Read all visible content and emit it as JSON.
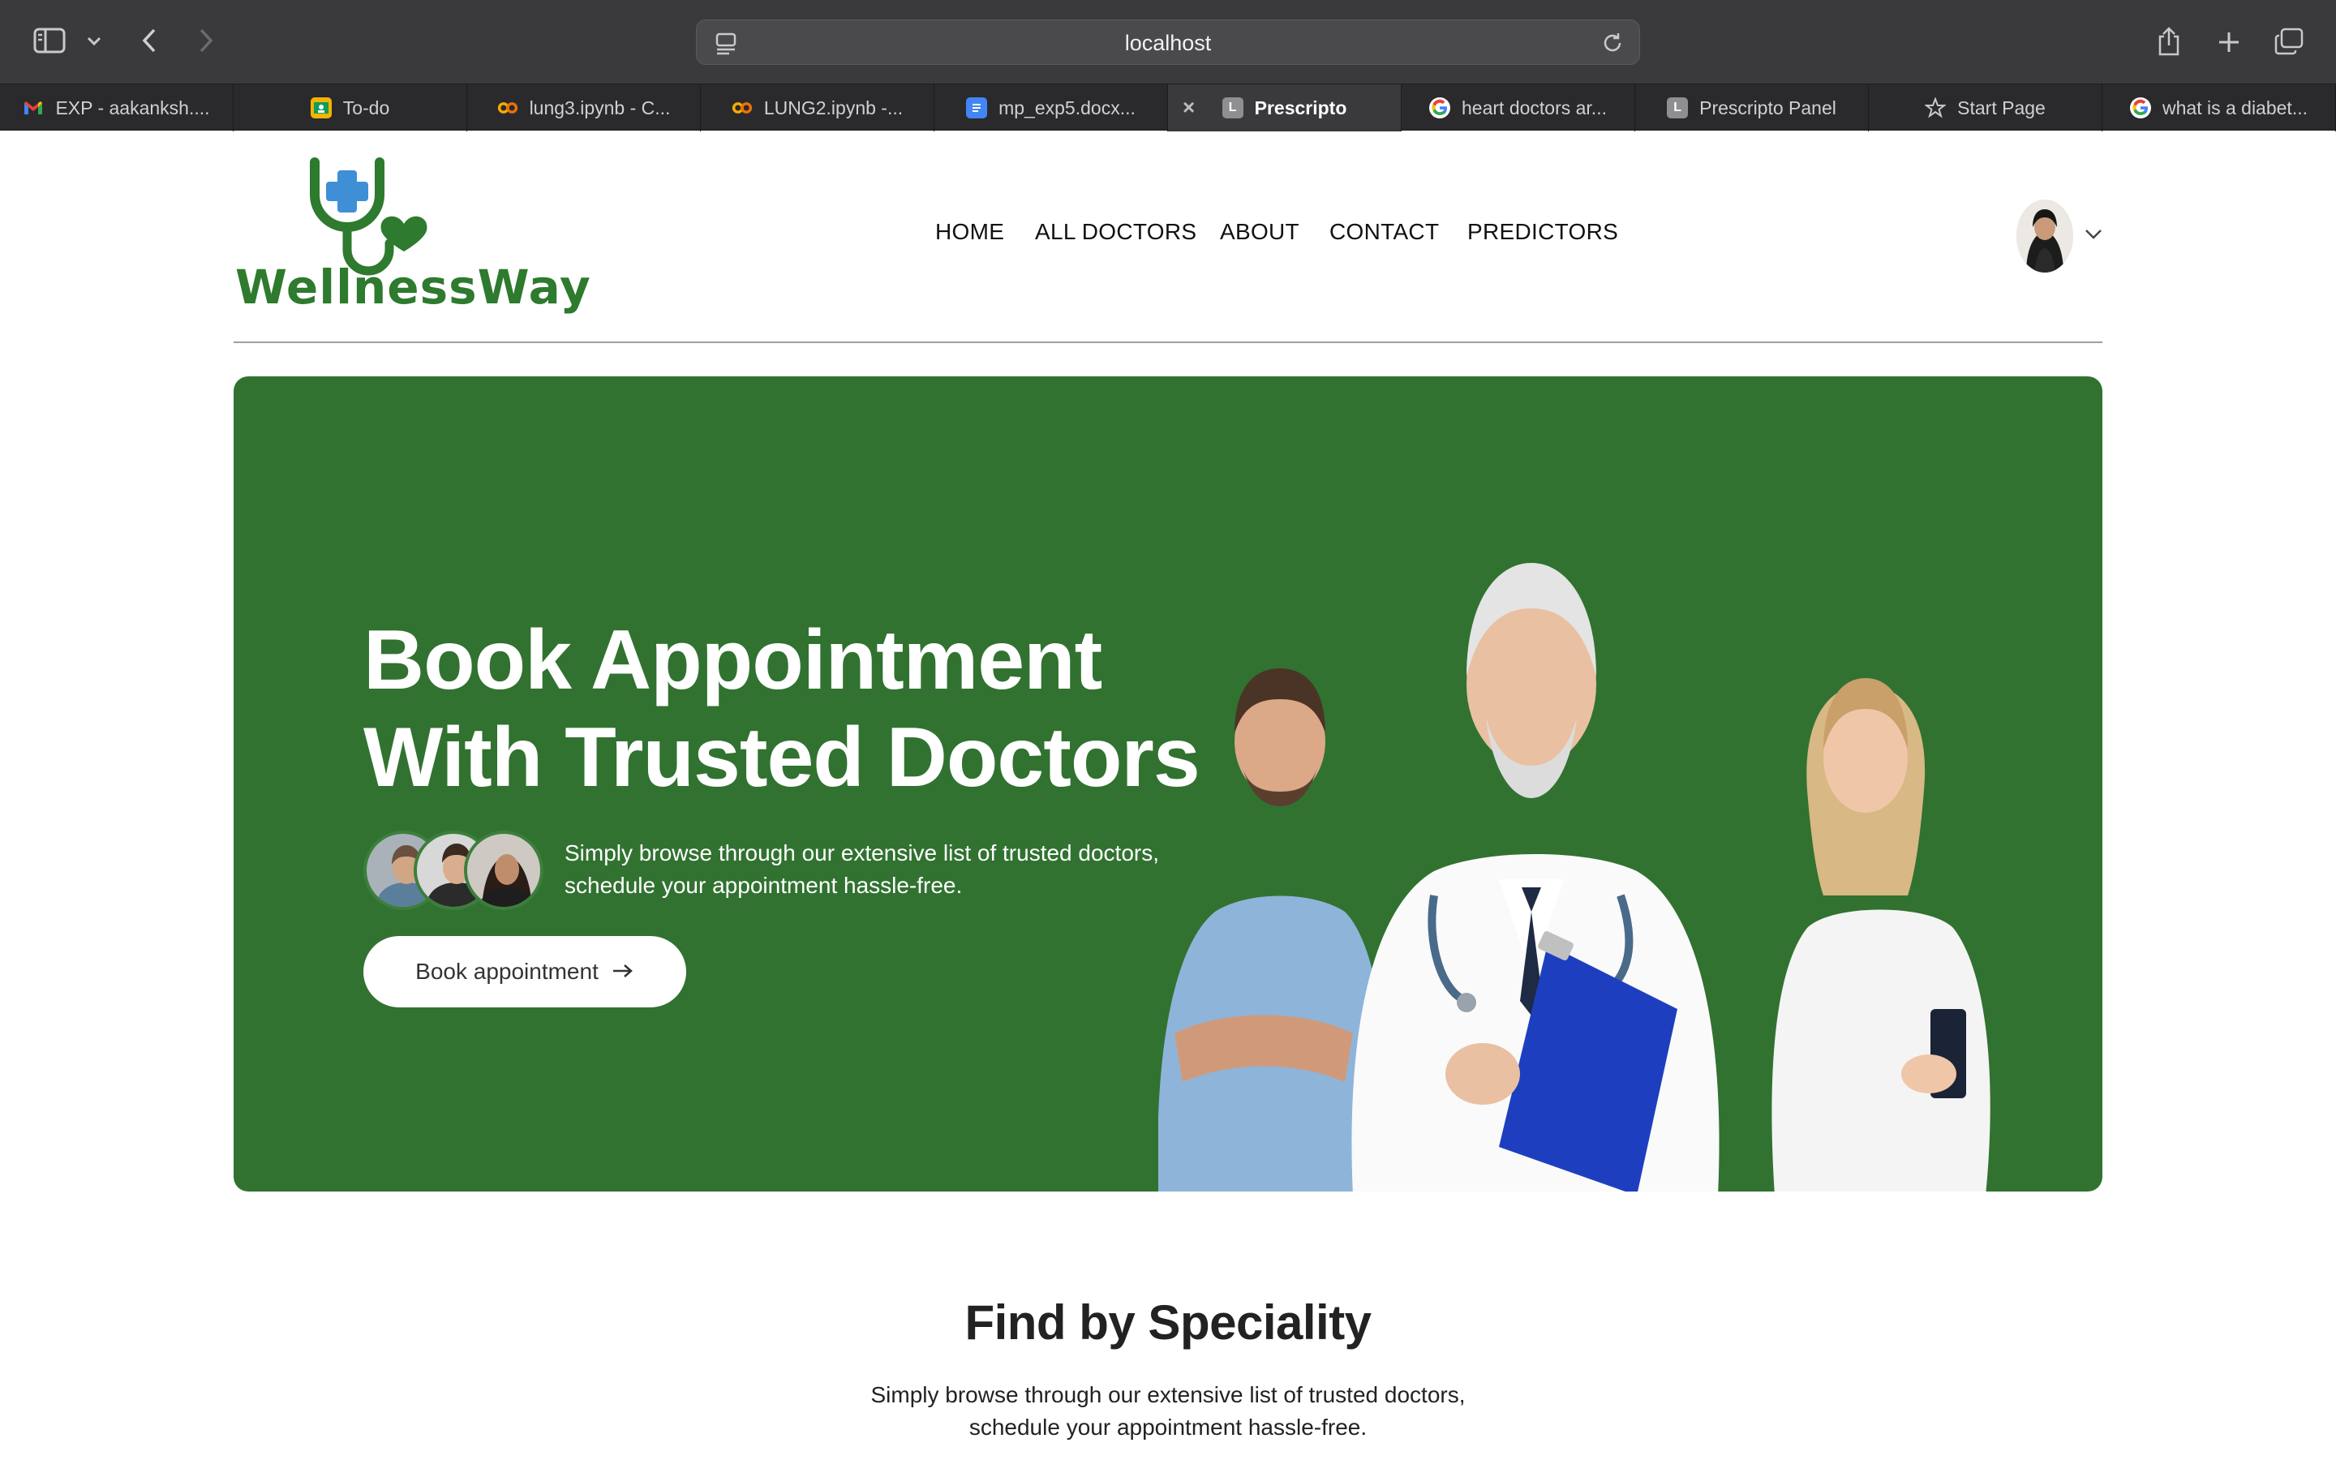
{
  "browser": {
    "url": "localhost",
    "tabs": [
      {
        "label": "EXP - aakanksh....",
        "favicon": "gmail-icon",
        "color": "#d93025"
      },
      {
        "label": "To-do",
        "favicon": "classroom-icon",
        "color": "#f4b400"
      },
      {
        "label": "lung3.ipynb - C...",
        "favicon": "colab-icon",
        "color": "#f9ab00"
      },
      {
        "label": "LUNG2.ipynb -...",
        "favicon": "colab-icon",
        "color": "#f9ab00"
      },
      {
        "label": "mp_exp5.docx...",
        "favicon": "docs-icon",
        "color": "#4285f4"
      },
      {
        "label": "Prescripto",
        "favicon": "letter-l-icon",
        "color": "#8e8e93",
        "active": true
      },
      {
        "label": "heart doctors ar...",
        "favicon": "google-icon",
        "color": "#ffffff"
      },
      {
        "label": "Prescripto Panel",
        "favicon": "letter-l-icon",
        "color": "#8e8e93"
      },
      {
        "label": "Start Page",
        "favicon": "star-icon",
        "color": "#c9c9cc"
      },
      {
        "label": "what is a diabet...",
        "favicon": "google-icon",
        "color": "#ffffff"
      }
    ]
  },
  "site": {
    "logo_text": "WellnessWay",
    "brand_color": "#2e7a2e",
    "nav": {
      "home": "HOME",
      "doctors": "ALL DOCTORS",
      "about": "ABOUT",
      "contact": "CONTACT",
      "predictors": "PREDICTORS"
    }
  },
  "hero": {
    "title_line1": "Book Appointment",
    "title_line2": "With Trusted Doctors",
    "description_line1": "Simply browse through our extensive list of trusted doctors,",
    "description_line2": "schedule your appointment hassle-free.",
    "button_label": "Book appointment",
    "background": "#317231"
  },
  "speciality": {
    "title": "Find by Speciality",
    "description_line1": "Simply browse through our extensive list of trusted doctors,",
    "description_line2": "schedule your appointment hassle-free."
  }
}
